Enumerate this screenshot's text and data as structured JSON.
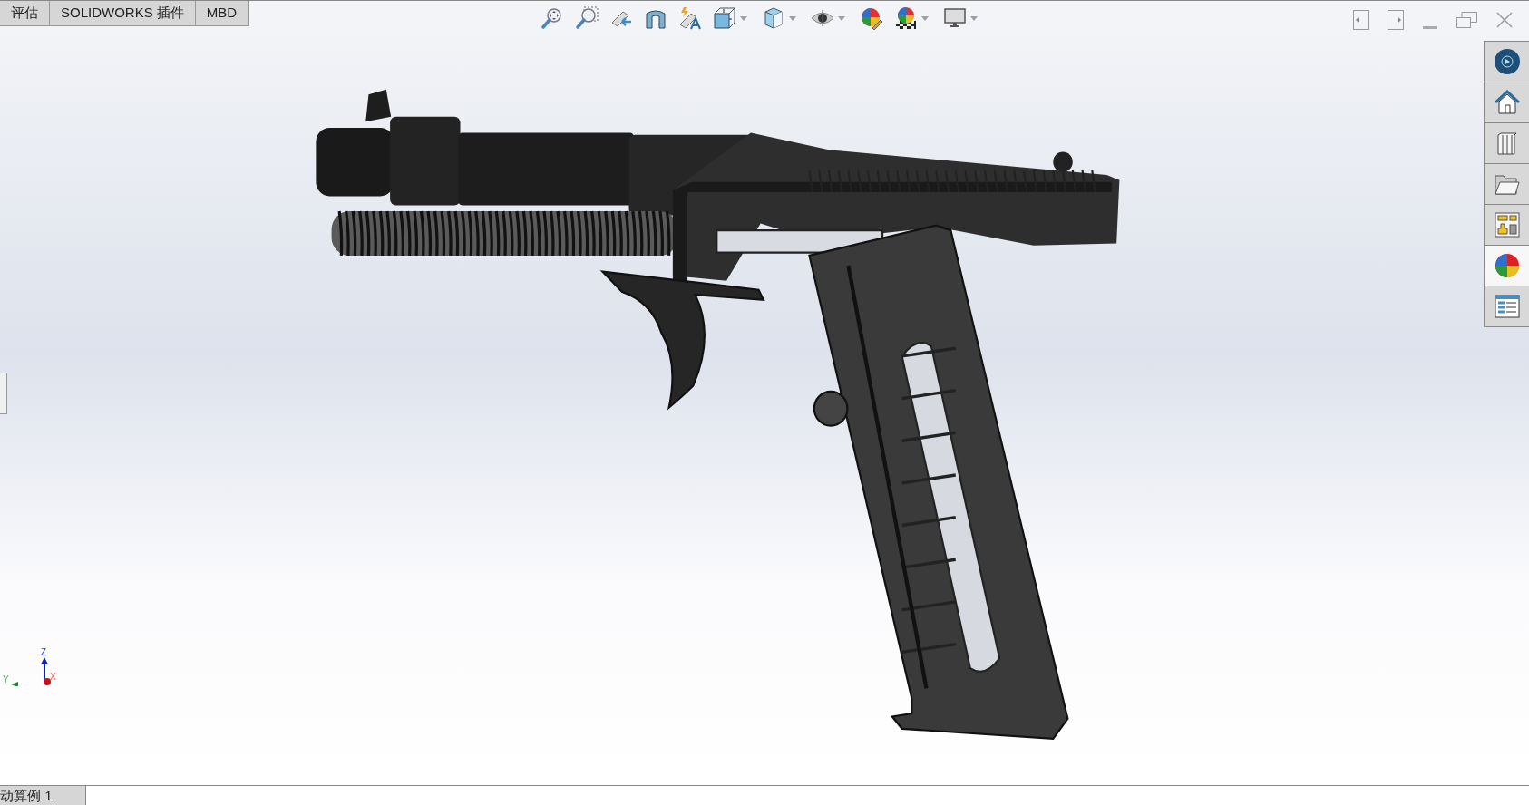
{
  "command_tabs": [
    {
      "label": "评估"
    },
    {
      "label": "SOLIDWORKS 插件"
    },
    {
      "label": "MBD"
    }
  ],
  "task_pane": {
    "items": [
      {
        "selected": false
      },
      {
        "selected": false
      },
      {
        "selected": false
      },
      {
        "selected": false
      },
      {
        "selected": false
      },
      {
        "selected": true
      },
      {
        "selected": false
      }
    ]
  },
  "triad": {
    "z_label": "Z",
    "x_label": "X",
    "y_label": "Y"
  },
  "bottom_tabs": [
    {
      "label": "动算例 1"
    }
  ]
}
